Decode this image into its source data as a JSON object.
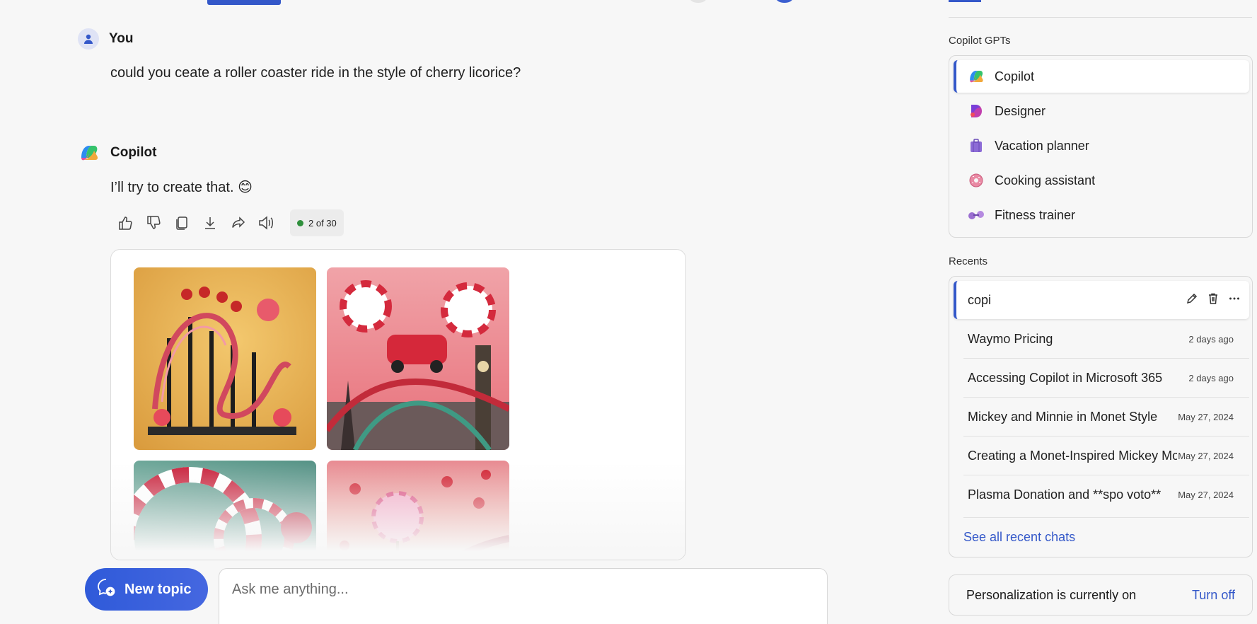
{
  "chat": {
    "user_name": "You",
    "user_message": "could you ceate a roller coaster ride in the style of cherry licorice?",
    "bot_name": "Copilot",
    "bot_message": "I’ll try to create that. 😊",
    "counter": "2 of 30"
  },
  "input": {
    "new_topic_label": "New topic",
    "placeholder": "Ask me anything..."
  },
  "sidebar": {
    "gpts_label": "Copilot GPTs",
    "gpts": [
      {
        "label": "Copilot",
        "icon": "copilot-icon"
      },
      {
        "label": "Designer",
        "icon": "designer-icon"
      },
      {
        "label": "Vacation planner",
        "icon": "suitcase-icon"
      },
      {
        "label": "Cooking assistant",
        "icon": "donut-icon"
      },
      {
        "label": "Fitness trainer",
        "icon": "dumbbell-icon"
      }
    ],
    "recents_label": "Recents",
    "recents": [
      {
        "title": "copi",
        "date": ""
      },
      {
        "title": "Waymo Pricing",
        "date": "2 days ago"
      },
      {
        "title": "Accessing Copilot in Microsoft 365",
        "date": "2 days ago"
      },
      {
        "title": "Mickey and Minnie in Monet Style",
        "date": "May 27, 2024"
      },
      {
        "title": "Creating a Monet-Inspired Mickey Mouse",
        "date": "May 27, 2024"
      },
      {
        "title": "Plasma Donation and **spo voto**",
        "date": "May 27, 2024"
      }
    ],
    "see_all": "See all recent chats",
    "personalization_text": "Personalization is currently on",
    "turn_off": "Turn off"
  },
  "colors": {
    "accent": "#3458c9",
    "background": "#f7f7f7",
    "status_green": "#2f8f3c"
  }
}
